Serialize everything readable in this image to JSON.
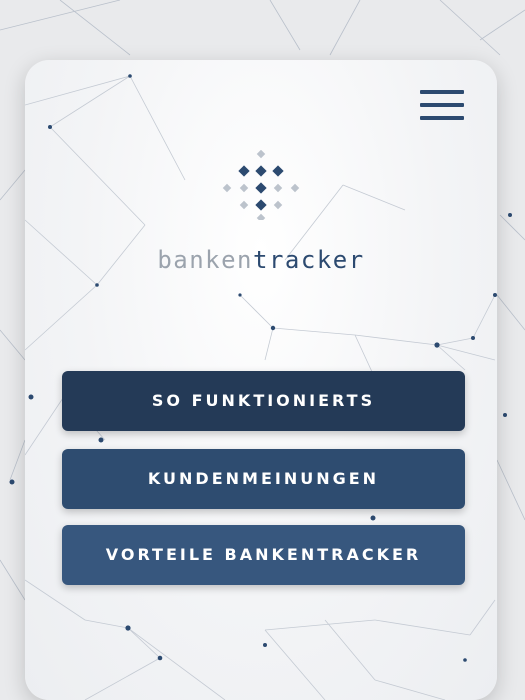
{
  "brand": {
    "name_part1": "banken",
    "name_part2": "tracker"
  },
  "menu": {
    "icon": "hamburger-menu-icon"
  },
  "buttons": [
    {
      "label": "SO FUNKTIONIERTS"
    },
    {
      "label": "KUNDENMEINUNGEN"
    },
    {
      "label": "VORTEILE BANKENTRACKER"
    }
  ],
  "colors": {
    "primary_dark": "#243a57",
    "primary_mid": "#2e4c70",
    "primary_light": "#37577e",
    "logo_gray": "#9ba3ad",
    "background": "#e9eaec"
  }
}
